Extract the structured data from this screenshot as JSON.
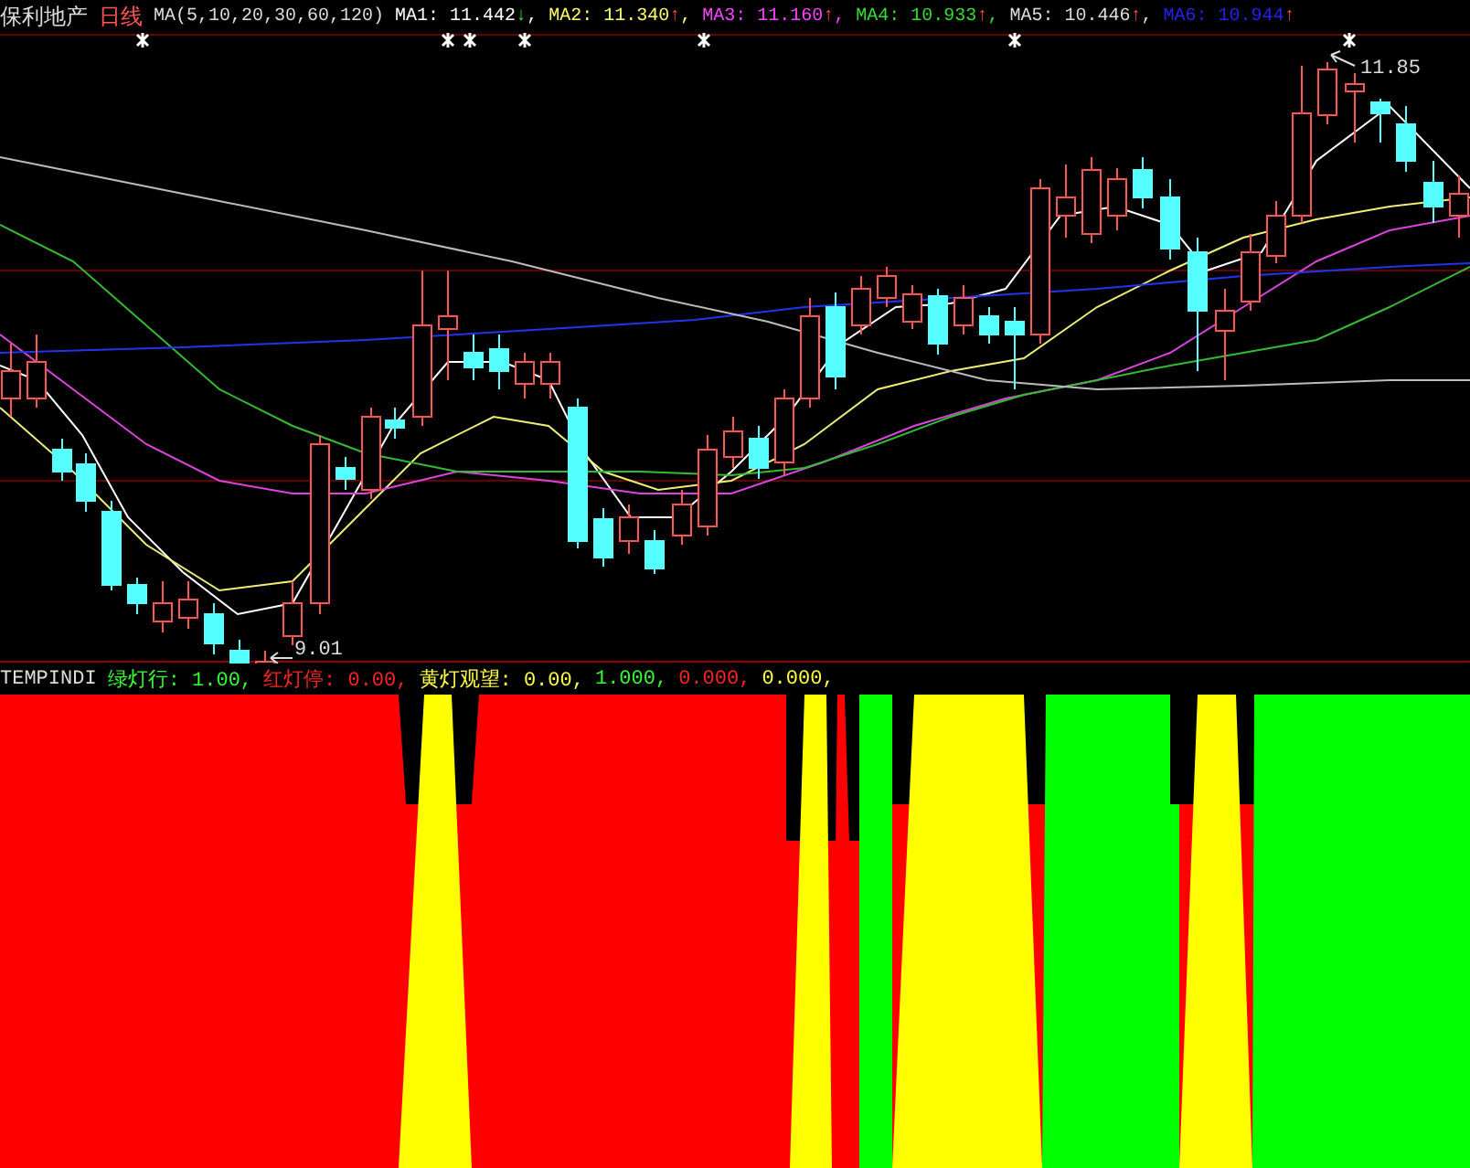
{
  "header": {
    "stock_name": "保利地产",
    "period": "日线",
    "ma_params": "MA(5,10,20,30,60,120)",
    "averages": [
      {
        "label": "MA1:",
        "value": "11.442",
        "arrow": "↓",
        "rising": false,
        "separator": ",",
        "color": "#ffffff"
      },
      {
        "label": "MA2:",
        "value": "11.340",
        "arrow": "↑",
        "rising": true,
        "separator": ",",
        "color": "#ffff66"
      },
      {
        "label": "MA3:",
        "value": "11.160",
        "arrow": "↑",
        "rising": true,
        "separator": ",",
        "color": "#ff44ff"
      },
      {
        "label": "MA4:",
        "value": "10.933",
        "arrow": "↑",
        "rising": true,
        "separator": ",",
        "color": "#33dd33"
      },
      {
        "label": "MA5:",
        "value": "10.446",
        "arrow": "↑",
        "rising": true,
        "separator": ",",
        "color": "#dddddd"
      },
      {
        "label": "MA6:",
        "value": "10.944",
        "arrow": "↑",
        "rising": true,
        "color": "#2222ee"
      }
    ]
  },
  "price_chart": {
    "high_label": "11.85",
    "low_label": "9.01"
  },
  "indicator": {
    "name": "TEMPINDI",
    "items": [
      {
        "label": "绿灯行:",
        "value": "1.00,",
        "color": "#33ff33"
      },
      {
        "label": "红灯停:",
        "value": "0.00,",
        "color": "#ff2222"
      },
      {
        "label": "黄灯观望:",
        "value": "0.00,",
        "color": "#ffff44"
      }
    ],
    "extra_values": [
      {
        "value": "1.000,",
        "color": "#33ff33"
      },
      {
        "value": "0.000,",
        "color": "#ff2222"
      },
      {
        "value": "0.000,",
        "color": "#ffff44"
      }
    ]
  }
}
